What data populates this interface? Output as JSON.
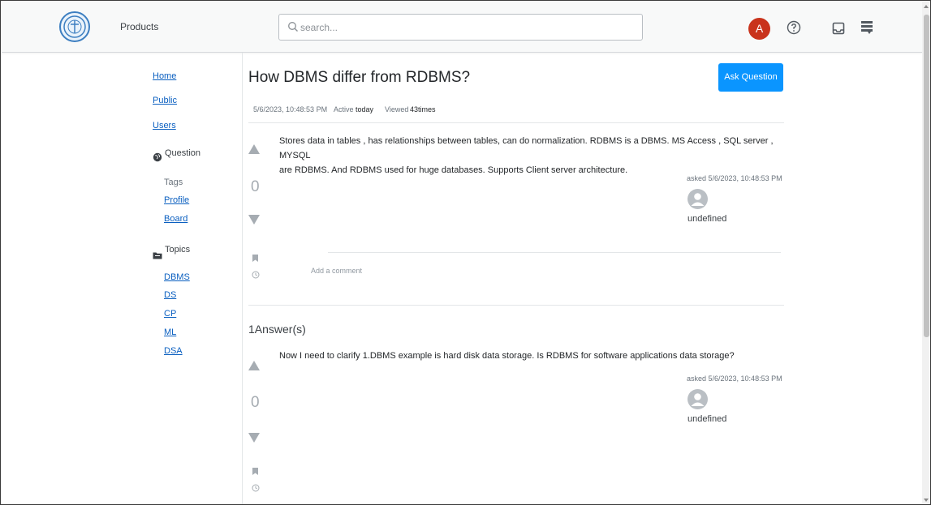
{
  "header": {
    "products_label": "Products",
    "search_placeholder": "search...",
    "avatar_letter": "A",
    "icons": {
      "logo": "university-seal-logo",
      "search": "search-icon",
      "help": "help-circle-icon",
      "inbox": "inbox-icon",
      "achievements": "achievements-icon"
    }
  },
  "sidebar": {
    "home": "Home",
    "public": "Public",
    "users": "Users",
    "question_heading": "Question",
    "tags": "Tags",
    "profile": "Profile",
    "board": "Board",
    "topics_heading": "Topics",
    "topics": [
      "DBMS",
      "DS",
      "CP",
      "ML",
      "DSA"
    ],
    "icons": {
      "question": "globe-icon",
      "topics": "folder-icon"
    }
  },
  "question": {
    "title": "How DBMS differ from RDBMS?",
    "ask_button": "Ask Question",
    "created": "5/6/2023, 10:48:53 PM",
    "active_label": "Active",
    "active_value": "today",
    "viewed_label": "Viewed",
    "viewed_value": "43times",
    "body_line1": "Stores data in tables , has relationships between tables, can do normalization. RDBMS is a DBMS. MS Access , SQL server , MYSQL",
    "body_line2": "are RDBMS. And RDBMS used for huge databases. Supports Client server architecture.",
    "vote_count": "0",
    "asked": "asked 5/6/2023, 10:48:53 PM",
    "user": "undefined",
    "add_comment": "Add a comment"
  },
  "answers": {
    "heading": "1Answer(s)",
    "items": [
      {
        "body": "Now I need to clarify 1.DBMS example is hard disk data storage. Is RDBMS for software applications data storage?",
        "vote_count": "0",
        "asked": "asked 5/6/2023, 10:48:53 PM",
        "user": "undefined"
      }
    ]
  },
  "colors": {
    "accent": "#0a95ff",
    "link": "#0a5fc0",
    "avatar_bg": "#c9331c",
    "vote_gray": "#a6acb2"
  }
}
